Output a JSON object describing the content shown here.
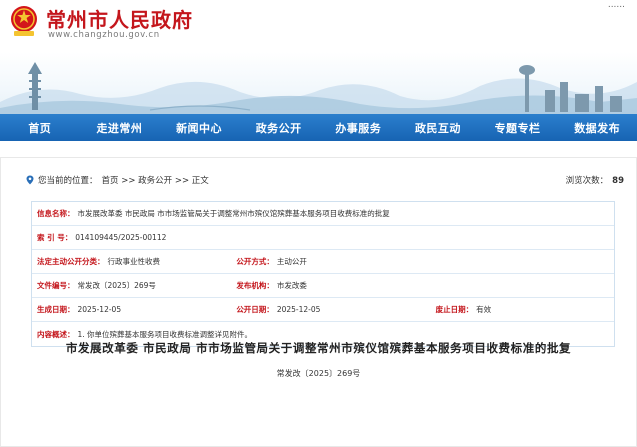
{
  "header": {
    "site_name": "常州市人民政府",
    "site_url": "www.changzhou.gov.cn",
    "top_links": "......"
  },
  "nav": {
    "items": [
      "首页",
      "走进常州",
      "新闻中心",
      "政务公开",
      "办事服务",
      "政民互动",
      "专题专栏",
      "数据发布"
    ]
  },
  "breadcrumb": {
    "prefix": "您当前的位置：",
    "path": "首页 >> 政务公开 >> 正文"
  },
  "views": {
    "label": "浏览次数：",
    "count": "89"
  },
  "info": {
    "source_label": "信息名称：",
    "source_value": "市发展改革委 市民政局 市市场监管局关于调整常州市殡仪馆殡葬基本服务项目收费标准的批复",
    "index_label": "索 引 号：",
    "index_value": "014109445/2025-00112",
    "category_label": "法定主动公开分类：",
    "category_value": "行政事业性收费",
    "method_label": "公开方式：",
    "method_value": "主动公开",
    "docno_label": "文件编号：",
    "docno_value": "常发改〔2025〕269号",
    "org_label": "发布机构：",
    "org_value": "市发改委",
    "effective_label": "生成日期：",
    "effective_value": "2025-12-05",
    "pubdate_label": "公开日期：",
    "pubdate_value": "2025-12-05",
    "status_label": "废止日期：",
    "status_value": "有效",
    "summary_label": "内容概述：",
    "summary_value": "1. 你单位殡葬基本服务项目收费标准调整详见附件。"
  },
  "document": {
    "title": "市发展改革委  市民政局  市市场监管局关于调整常州市殡仪馆殡葬基本服务项目收费标准的批复",
    "number": "常发改〔2025〕269号"
  },
  "colors": {
    "brand_red": "#c4161c",
    "nav_blue": "#1d6fc1"
  }
}
